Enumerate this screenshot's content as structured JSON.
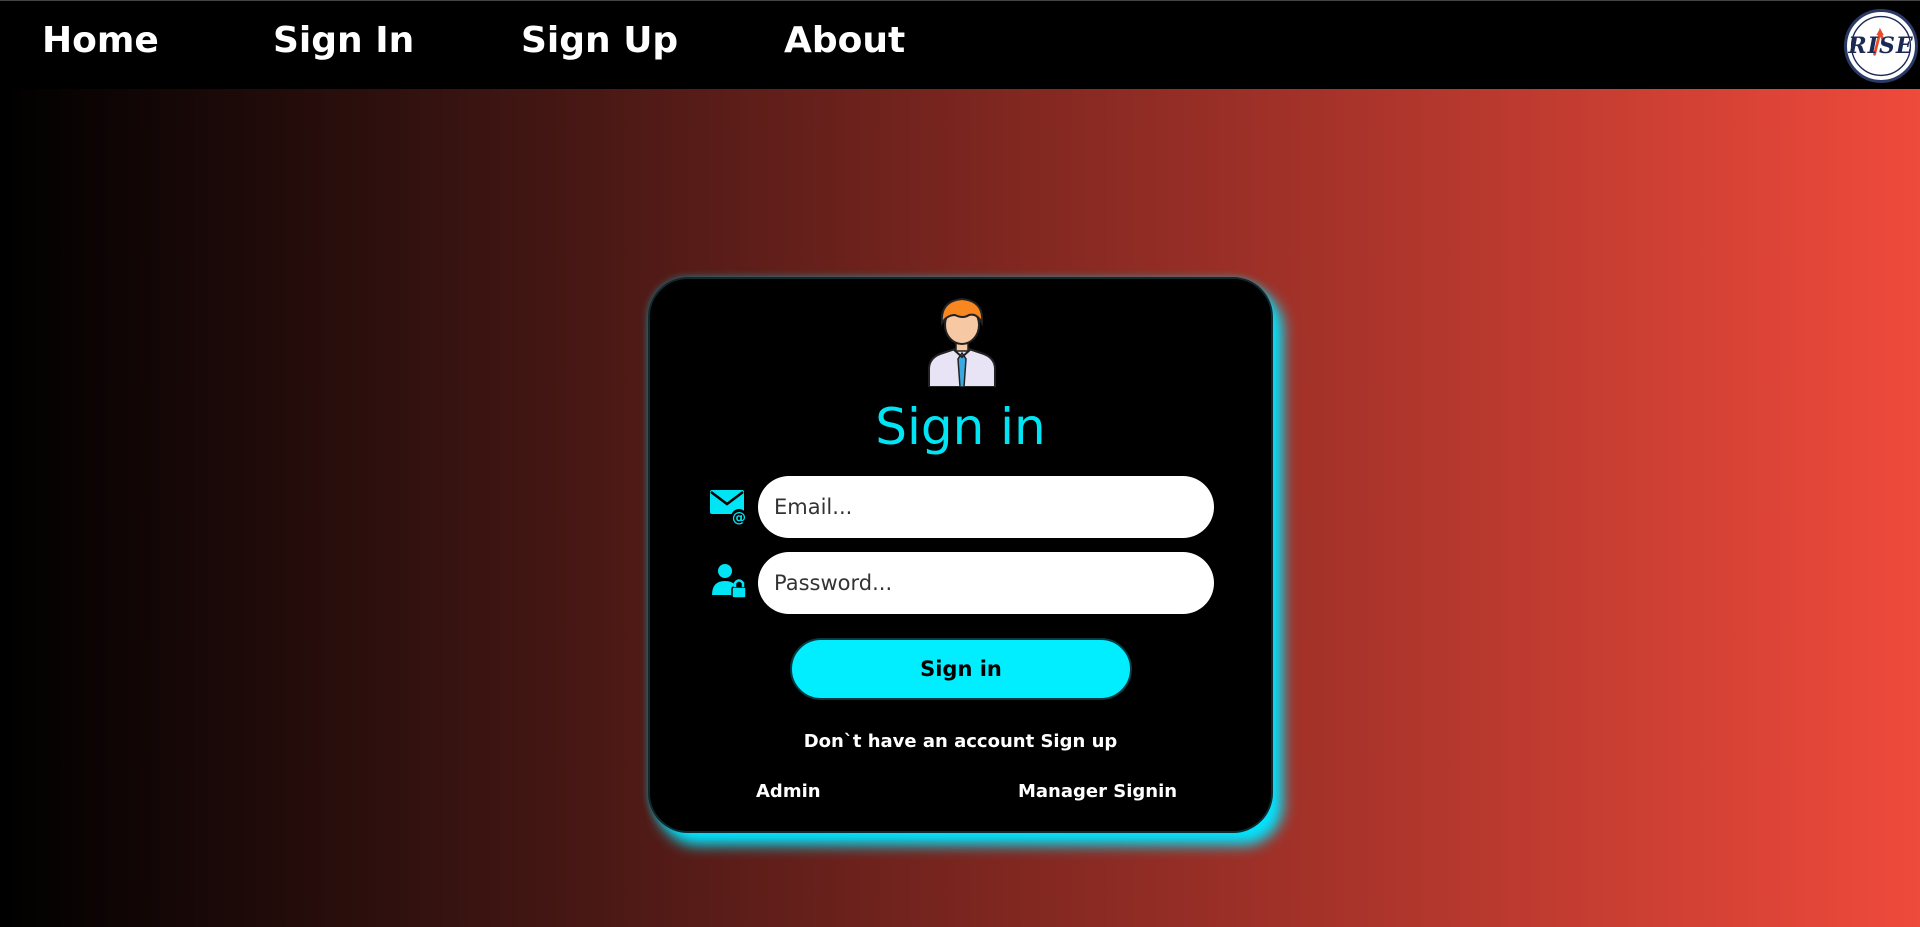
{
  "nav": {
    "items": [
      {
        "label": "Home"
      },
      {
        "label": "Sign In"
      },
      {
        "label": "Sign Up"
      },
      {
        "label": "About"
      }
    ],
    "logo_text": "RISE"
  },
  "form": {
    "title": "Sign in",
    "email_placeholder": "Email...",
    "email_value": "",
    "password_placeholder": "Password...",
    "password_value": "",
    "submit_label": "Sign in",
    "signup_prompt": "Don`t have an account",
    "signup_link": "Sign up",
    "admin_link": "Admin",
    "manager_link": "Manager Signin"
  },
  "icons": {
    "avatar": "user-avatar-icon",
    "email": "email-at-icon",
    "password": "user-lock-icon",
    "logo": "rise-logo"
  },
  "colors": {
    "accent": "#00e5ff",
    "card_bg": "#000000",
    "nav_bg": "#000000",
    "gradient_start": "#000000",
    "gradient_end": "#ef4a3b",
    "avatar_hair": "#f7871e"
  }
}
